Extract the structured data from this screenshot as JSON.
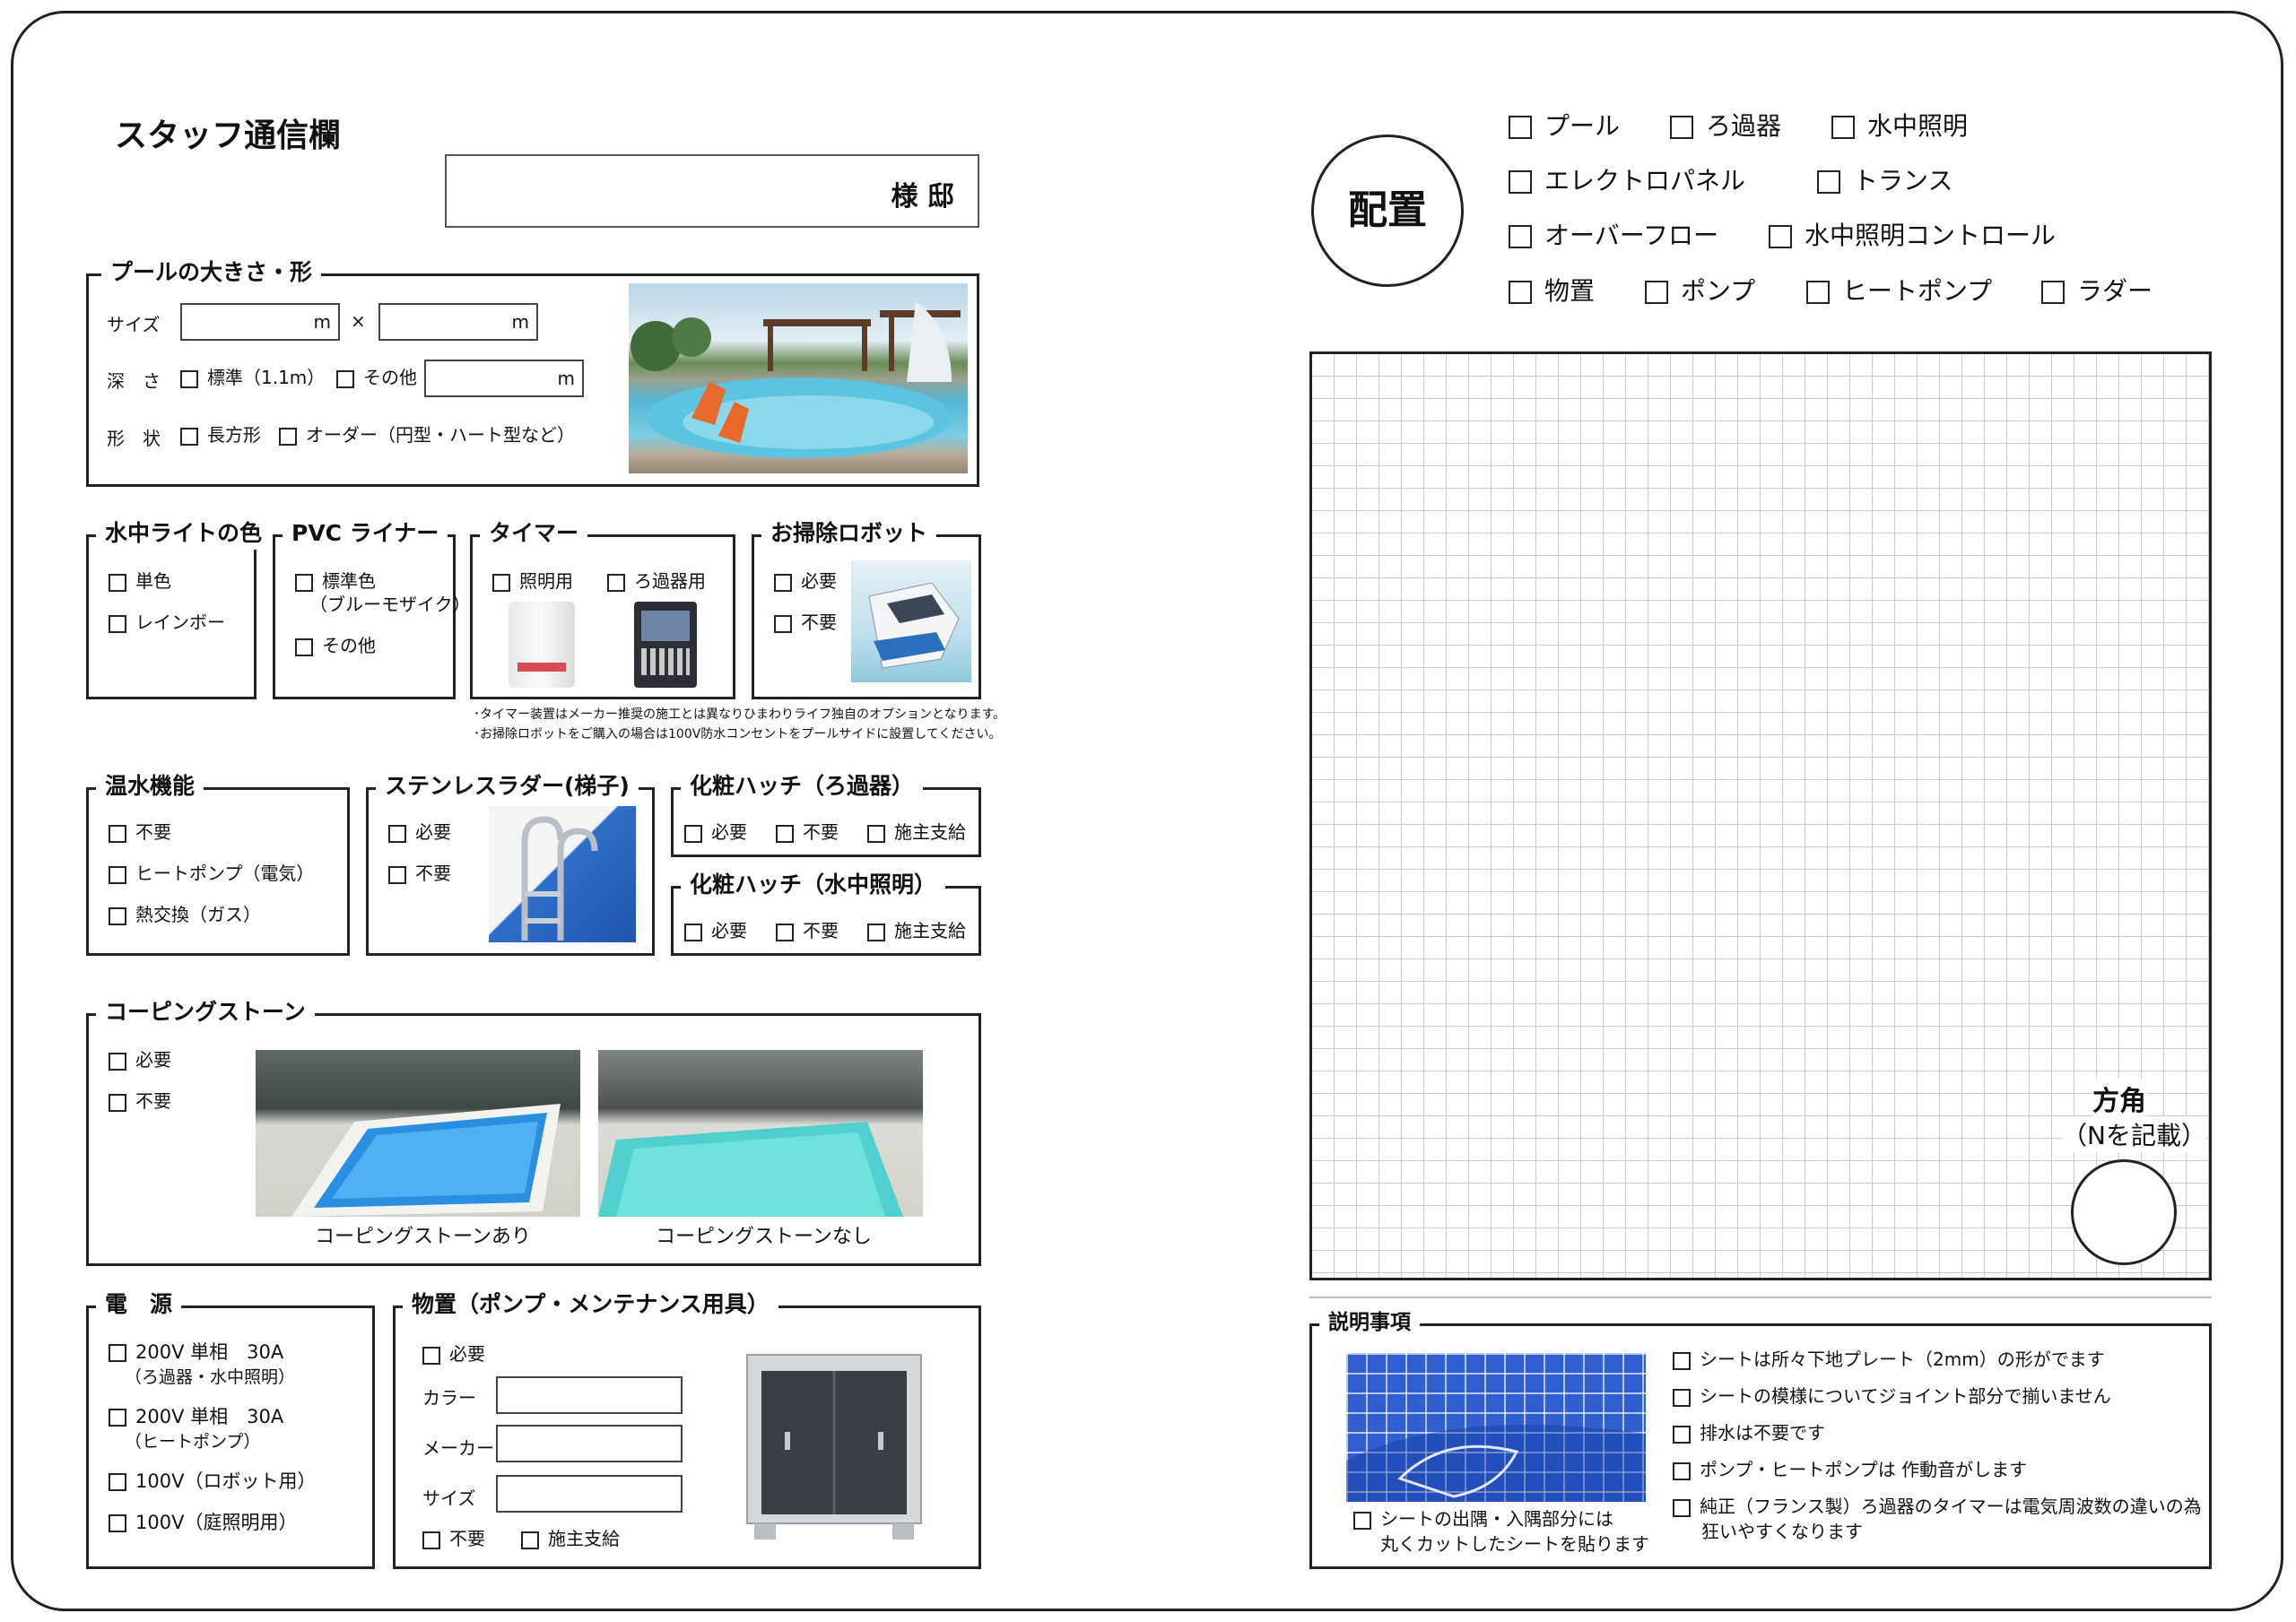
{
  "header": {
    "title": "スタッフ通信欄",
    "name_suffix": "様 邸"
  },
  "pool_size": {
    "legend": "プールの大きさ・形",
    "size_label": "サイズ",
    "unit": "m",
    "times": "×",
    "depth_label": "深　さ",
    "depth_standard": "標準（1.1m）",
    "depth_other": "その他",
    "shape_label": "形　状",
    "shape_rect": "長方形",
    "shape_order": "オーダー（円型・ハート型など）"
  },
  "light_color": {
    "legend": "水中ライトの色",
    "items": [
      "単色",
      "レインボー"
    ]
  },
  "pvc_liner": {
    "legend": "PVC ライナー",
    "standard": "標準色",
    "standard_sub": "（ブルーモザイク）",
    "other": "その他"
  },
  "timer": {
    "legend": "タイマー",
    "items": [
      "照明用",
      "ろ過器用"
    ]
  },
  "robot": {
    "legend": "お掃除ロボット",
    "items": [
      "必要",
      "不要"
    ]
  },
  "notes": [
    "･タイマー装置はメーカー推奨の施工とは異なりひまわりライフ独自のオプションとなります。",
    "･お掃除ロボットをご購入の場合は100V防水コンセントをプールサイドに設置してください。"
  ],
  "heating": {
    "legend": "温水機能",
    "items": [
      "不要",
      "ヒートポンプ（電気）",
      "熱交換（ガス）"
    ]
  },
  "ladder": {
    "legend": "ステンレスラダー(梯子)",
    "items": [
      "必要",
      "不要"
    ]
  },
  "hatch_filter": {
    "legend": "化粧ハッチ（ろ過器）",
    "items": [
      "必要",
      "不要",
      "施主支給"
    ]
  },
  "hatch_light": {
    "legend": "化粧ハッチ（水中照明）",
    "items": [
      "必要",
      "不要",
      "施主支給"
    ]
  },
  "coping": {
    "legend": "コーピングストーン",
    "items": [
      "必要",
      "不要"
    ],
    "caption_with": "コーピングストーンあり",
    "caption_without": "コーピングストーンなし"
  },
  "power": {
    "legend": "電　源",
    "items": [
      {
        "main": "200V 単相　30A",
        "sub": "（ろ過器・水中照明）"
      },
      {
        "main": "200V 単相　30A",
        "sub": "（ヒートポンプ）"
      },
      {
        "main": "100V（ロボット用）",
        "sub": ""
      },
      {
        "main": "100V（庭照明用）",
        "sub": ""
      }
    ]
  },
  "storage": {
    "legend": "物置（ポンプ・メンテナンス用具）",
    "required": "必要",
    "color_label": "カラー",
    "maker_label": "メーカー",
    "size_label": "サイズ",
    "not_needed": "不要",
    "owner_supplied": "施主支給"
  },
  "layout": {
    "circle_label": "配置",
    "row1": [
      "プール",
      "ろ過器",
      "水中照明"
    ],
    "row2": [
      "エレクトロパネル",
      "トランス"
    ],
    "row3": [
      "オーバーフロー",
      "水中照明コントロール"
    ],
    "row4": [
      "物置",
      "ポンプ",
      "ヒートポンプ",
      "ラダー"
    ]
  },
  "direction": {
    "title": "方角",
    "sub": "（Nを記載）"
  },
  "explanation": {
    "legend": "説明事項",
    "photo_caption_1": "シートの出隅・入隅部分には",
    "photo_caption_2": "丸くカットしたシートを貼ります",
    "items": [
      "シートは所々下地プレート（2mm）の形がでます",
      "シートの模様についてジョイント部分で揃いません",
      "排水は不要です",
      "ポンプ・ヒートポンプは 作動音がします",
      "純正（フランス製）ろ過器のタイマーは電気周波数の違いの為"
    ],
    "item5_line2": "狂いやすくなります"
  }
}
